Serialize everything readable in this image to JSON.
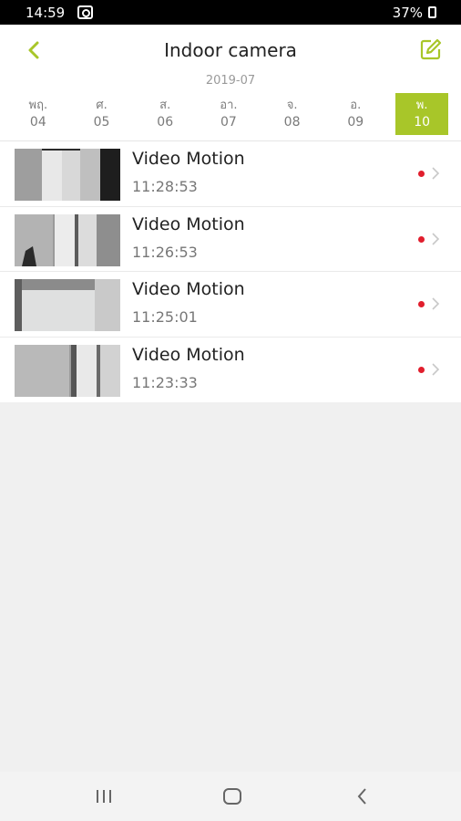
{
  "status": {
    "time": "14:59",
    "battery": "37%"
  },
  "header": {
    "title": "Indoor camera",
    "month": "2019-07"
  },
  "days": [
    {
      "abbr": "พฤ.",
      "num": "04"
    },
    {
      "abbr": "ศ.",
      "num": "05"
    },
    {
      "abbr": "ส.",
      "num": "06"
    },
    {
      "abbr": "อา.",
      "num": "07"
    },
    {
      "abbr": "จ.",
      "num": "08"
    },
    {
      "abbr": "อ.",
      "num": "09"
    },
    {
      "abbr": "พ.",
      "num": "10"
    }
  ],
  "events": [
    {
      "title": "Video Motion",
      "time": "11:28:53"
    },
    {
      "title": "Video Motion",
      "time": "11:26:53"
    },
    {
      "title": "Video Motion",
      "time": "11:25:01"
    },
    {
      "title": "Video Motion",
      "time": "11:23:33"
    }
  ],
  "colors": {
    "accent": "#a8c629",
    "status_dot": "#e11e2d"
  },
  "icons": [
    "back-arrow-icon",
    "edit-icon",
    "chevron-right-icon",
    "recents-icon",
    "home-icon",
    "back-icon"
  ]
}
